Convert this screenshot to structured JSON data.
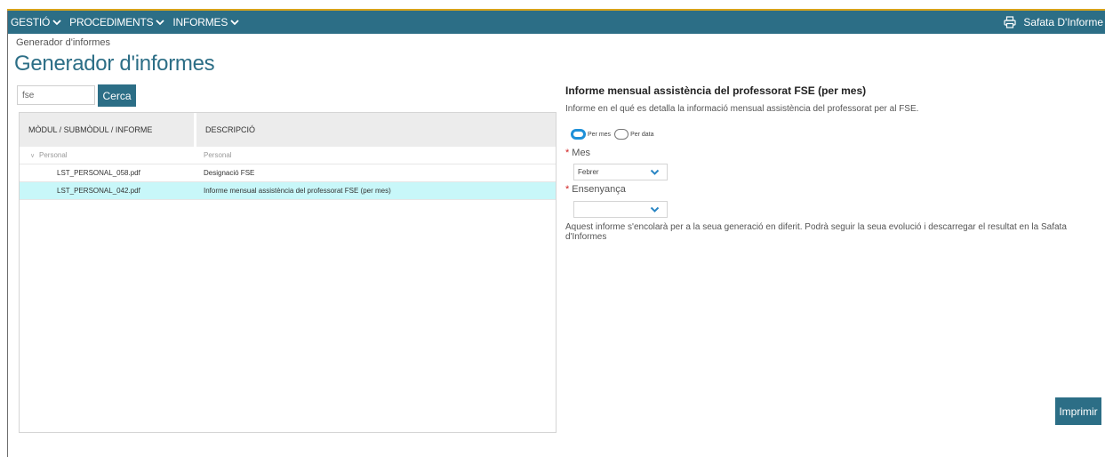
{
  "topbar": {
    "menus": [
      {
        "label": "GESTIÓ"
      },
      {
        "label": "PROCEDIMENTS"
      },
      {
        "label": "INFORMES"
      }
    ],
    "tray_label": "Safata D'Informe"
  },
  "breadcrumb": "Generador d'informes",
  "page_title": "Generador d'informes",
  "search": {
    "value": "fse",
    "button_label": "Cerca"
  },
  "table": {
    "headers": [
      "MÒDUL / SUBMÒDUL / INFORME",
      "DESCRIPCIÓ"
    ],
    "rows": [
      {
        "name": "Personal",
        "description": "Personal"
      },
      {
        "name": "LST_PERSONAL_058.pdf",
        "description": "Designació FSE"
      },
      {
        "name": "LST_PERSONAL_042.pdf",
        "description": "Informe mensual assistència del professorat FSE (per mes)"
      }
    ]
  },
  "detail": {
    "title": "Informe mensual assistència del professorat FSE (per mes)",
    "description": "Informe en el qué es detalla la informació mensual assistència del professorat per al FSE.",
    "radio_per_mes": "Per mes",
    "radio_per_data": "Per data",
    "mes_label": "Mes",
    "mes_value": "Febrer",
    "ensenyanca_label": "Ensenyança",
    "ensenyanca_value": "",
    "required_mark": "*",
    "info": "Aquest informe s'encolarà per a la seua generació en diferit. Podrà seguir la seua evolució i descarregar el resultat en la Safata d'Informes",
    "print_label": "Imprimir"
  },
  "colors": {
    "brand": "#2c6e86",
    "selected_row": "#c8f7f9",
    "radio_active": "#1e90d8",
    "required": "#d02020"
  }
}
